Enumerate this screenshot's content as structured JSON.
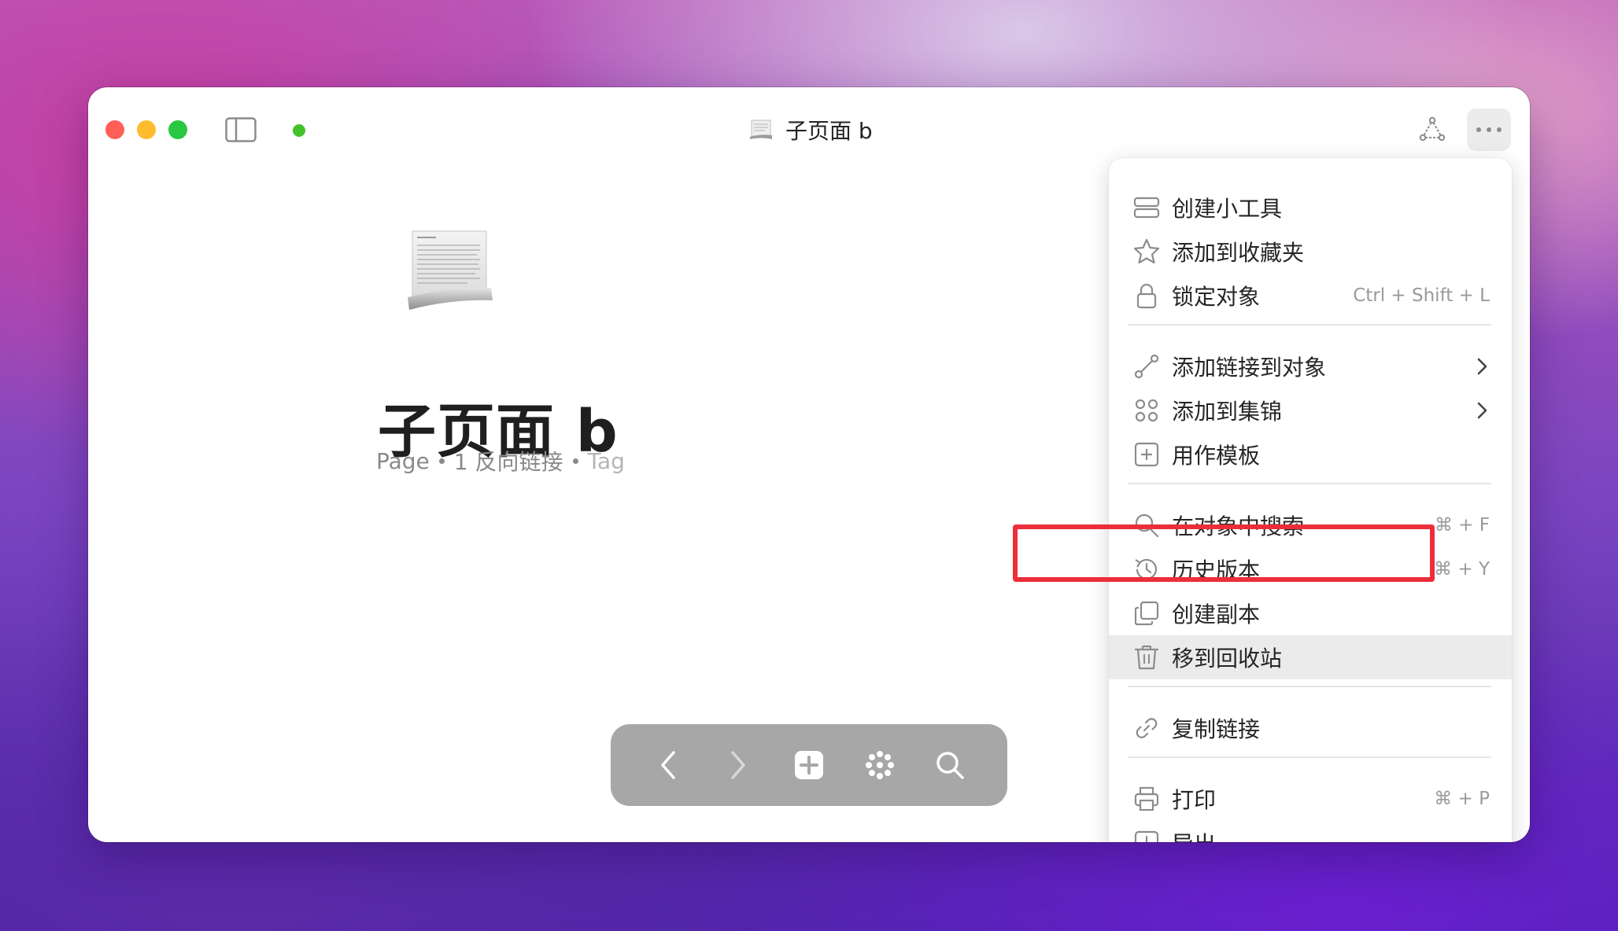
{
  "window": {
    "title": "子页面 b"
  },
  "page": {
    "title": "子页面 b",
    "type_label": "Page",
    "backlinks": "1 反向链接",
    "tag_placeholder": "Tag"
  },
  "menu": {
    "items": [
      {
        "label": "创建小工具",
        "icon": "widget-icon"
      },
      {
        "label": "添加到收藏夹",
        "icon": "star-icon"
      },
      {
        "label": "锁定对象",
        "icon": "lock-icon",
        "shortcut": "Ctrl + Shift + L"
      },
      {
        "label": "添加链接到对象",
        "icon": "link-node-icon",
        "submenu": true
      },
      {
        "label": "添加到集锦",
        "icon": "collection-icon",
        "submenu": true
      },
      {
        "label": "用作模板",
        "icon": "template-icon"
      },
      {
        "label": "在对象中搜索",
        "icon": "search-icon",
        "shortcut": "⌘ + F"
      },
      {
        "label": "历史版本",
        "icon": "history-icon",
        "shortcut": "⌘ + Y"
      },
      {
        "label": "创建副本",
        "icon": "duplicate-icon"
      },
      {
        "label": "移到回收站",
        "icon": "trash-icon",
        "highlighted": true
      },
      {
        "label": "复制链接",
        "icon": "chain-link-icon"
      },
      {
        "label": "打印",
        "icon": "printer-icon",
        "shortcut": "⌘ + P"
      },
      {
        "label": "导出",
        "icon": "export-icon"
      }
    ]
  },
  "colors": {
    "highlight_border": "#ee2d3a",
    "status_dot": "#45c12a",
    "navbar_bg": "#a7a7a7"
  }
}
